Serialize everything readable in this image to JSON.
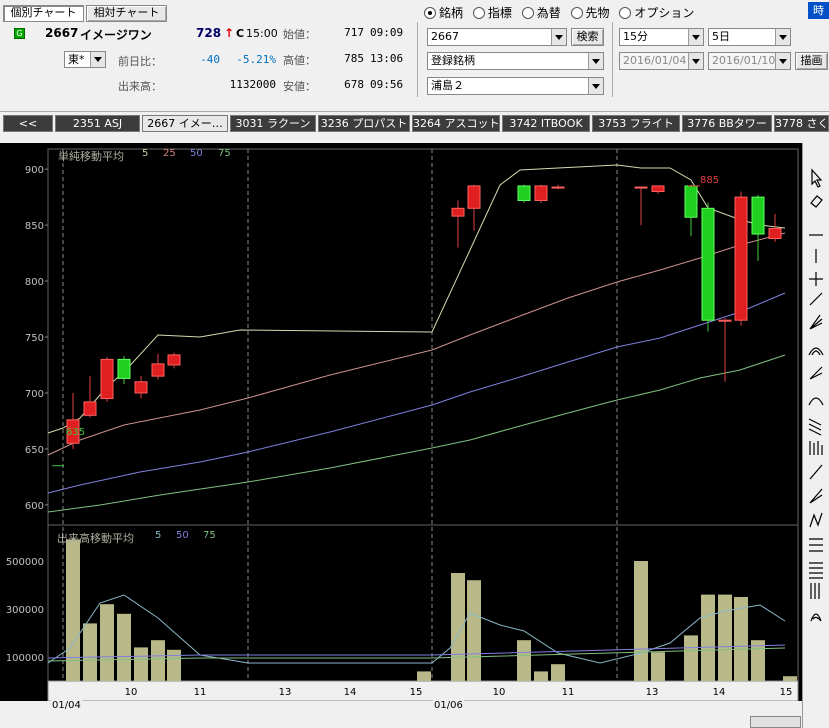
{
  "tabs_top": {
    "individual": "個別チャート",
    "relative": "相対チャート"
  },
  "header_right_btn": "時",
  "stock": {
    "code": "2667",
    "name": "イメージワン",
    "price": "728",
    "price_arrow": "↑",
    "price_flag": "C",
    "price_time": "15:00",
    "market": "東*",
    "change_label": "前日比：",
    "change": "-40",
    "change_pct": "-5.21%",
    "volume_label": "出来高：",
    "volume": "1132000",
    "open_label": "始値：",
    "open": "717",
    "open_time": "09:09",
    "high_label": "高値：",
    "high": "785",
    "high_time": "13:06",
    "low_label": "安値：",
    "low": "678",
    "low_time": "09:56"
  },
  "radios": [
    {
      "label": "銘柄",
      "selected": true
    },
    {
      "label": "指標",
      "selected": false
    },
    {
      "label": "為替",
      "selected": false
    },
    {
      "label": "先物",
      "selected": false
    },
    {
      "label": "オプション",
      "selected": false
    }
  ],
  "search": {
    "code": "2667",
    "button": "検索",
    "list": "登録銘柄",
    "group": "浦島２"
  },
  "period": {
    "interval": "15分",
    "span": "5日",
    "from": "2016/01/04",
    "to": "2016/01/10",
    "draw_button": "描画"
  },
  "ticker_tabs": [
    {
      "label": "<<"
    },
    {
      "label": "2351 ASJ"
    },
    {
      "label": "2667 イメー…",
      "active": true
    },
    {
      "label": "3031 ラクーン"
    },
    {
      "label": "3236 プロパスト"
    },
    {
      "label": "3264 アスコット"
    },
    {
      "label": "3742 ITBOOK"
    },
    {
      "label": "3753 フライト"
    },
    {
      "label": "3776 BBタワー"
    },
    {
      "label": "3778 さくら"
    }
  ],
  "chart_data": {
    "type": "candlestick",
    "price_panel": {
      "title": "単純移動平均",
      "ma_labels": [
        "5",
        "25",
        "50",
        "75"
      ],
      "y_ticks": [
        600,
        650,
        700,
        750,
        800,
        850,
        900
      ],
      "ylim": [
        582,
        918
      ],
      "high_marker": "885",
      "low_marker": "635"
    },
    "volume_panel": {
      "title": "出来高移動平均",
      "ma_labels": [
        "5",
        "50",
        "75"
      ],
      "y_ticks": [
        "100000",
        "300000",
        "500000"
      ],
      "ylim": [
        0,
        600000
      ]
    },
    "x_labels": [
      "10",
      "11",
      "13",
      "14",
      "15",
      "10",
      "11",
      "13",
      "14",
      "15"
    ],
    "dates": [
      "01/04",
      "01/06"
    ],
    "candles": [
      {
        "o": 655,
        "c": 676,
        "h": 700,
        "l": 650
      },
      {
        "o": 680,
        "c": 692,
        "h": 715,
        "l": 678
      },
      {
        "o": 695,
        "c": 730,
        "h": 732,
        "l": 692
      },
      {
        "o": 730,
        "c": 713,
        "h": 733,
        "l": 708
      },
      {
        "o": 700,
        "c": 710,
        "h": 715,
        "l": 695
      },
      {
        "o": 715,
        "c": 726,
        "h": 735,
        "l": 712
      },
      {
        "o": 725,
        "c": 734,
        "h": 736,
        "l": 722
      },
      {
        "o": 858,
        "c": 865,
        "h": 872,
        "l": 830
      },
      {
        "o": 865,
        "c": 885,
        "h": 886,
        "l": 845
      },
      {
        "o": 885,
        "c": 872,
        "h": 886,
        "l": 870
      },
      {
        "o": 872,
        "c": 885,
        "h": 886,
        "l": 870
      },
      {
        "o": 884,
        "c": 884,
        "h": 886,
        "l": 882
      },
      {
        "o": 884,
        "c": 884,
        "h": 884,
        "l": 850
      },
      {
        "o": 880,
        "c": 885,
        "h": 885,
        "l": 878
      },
      {
        "o": 885,
        "c": 857,
        "h": 886,
        "l": 840
      },
      {
        "o": 865,
        "c": 765,
        "h": 870,
        "l": 755
      },
      {
        "o": 765,
        "c": 765,
        "h": 767,
        "l": 710
      },
      {
        "o": 765,
        "c": 875,
        "h": 880,
        "l": 760
      },
      {
        "o": 875,
        "c": 842,
        "h": 877,
        "l": 818
      },
      {
        "o": 838,
        "c": 847,
        "h": 860,
        "l": 835
      }
    ],
    "volumes": [
      590000,
      240000,
      320000,
      280000,
      140000,
      170000,
      130000,
      450000,
      420000,
      170000,
      40000,
      70000,
      40000,
      500000,
      120000,
      190000,
      360000,
      360000,
      350000,
      170000,
      20000
    ]
  },
  "toolbar_icons": [
    "cursor-icon",
    "eraser-icon",
    "horizontal-line-icon",
    "vertical-line-icon",
    "cross-line-icon",
    "trend-line-icon",
    "fan-icon",
    "arc-icon",
    "fibo-fan-icon",
    "fibo-arc-icon",
    "channel-icon",
    "fibo-bars-icon",
    "tangent-icon",
    "gann-icon",
    "zigzag-icon",
    "three-line-icon",
    "four-line-icon",
    "parallel-icon",
    "spiral-icon"
  ]
}
